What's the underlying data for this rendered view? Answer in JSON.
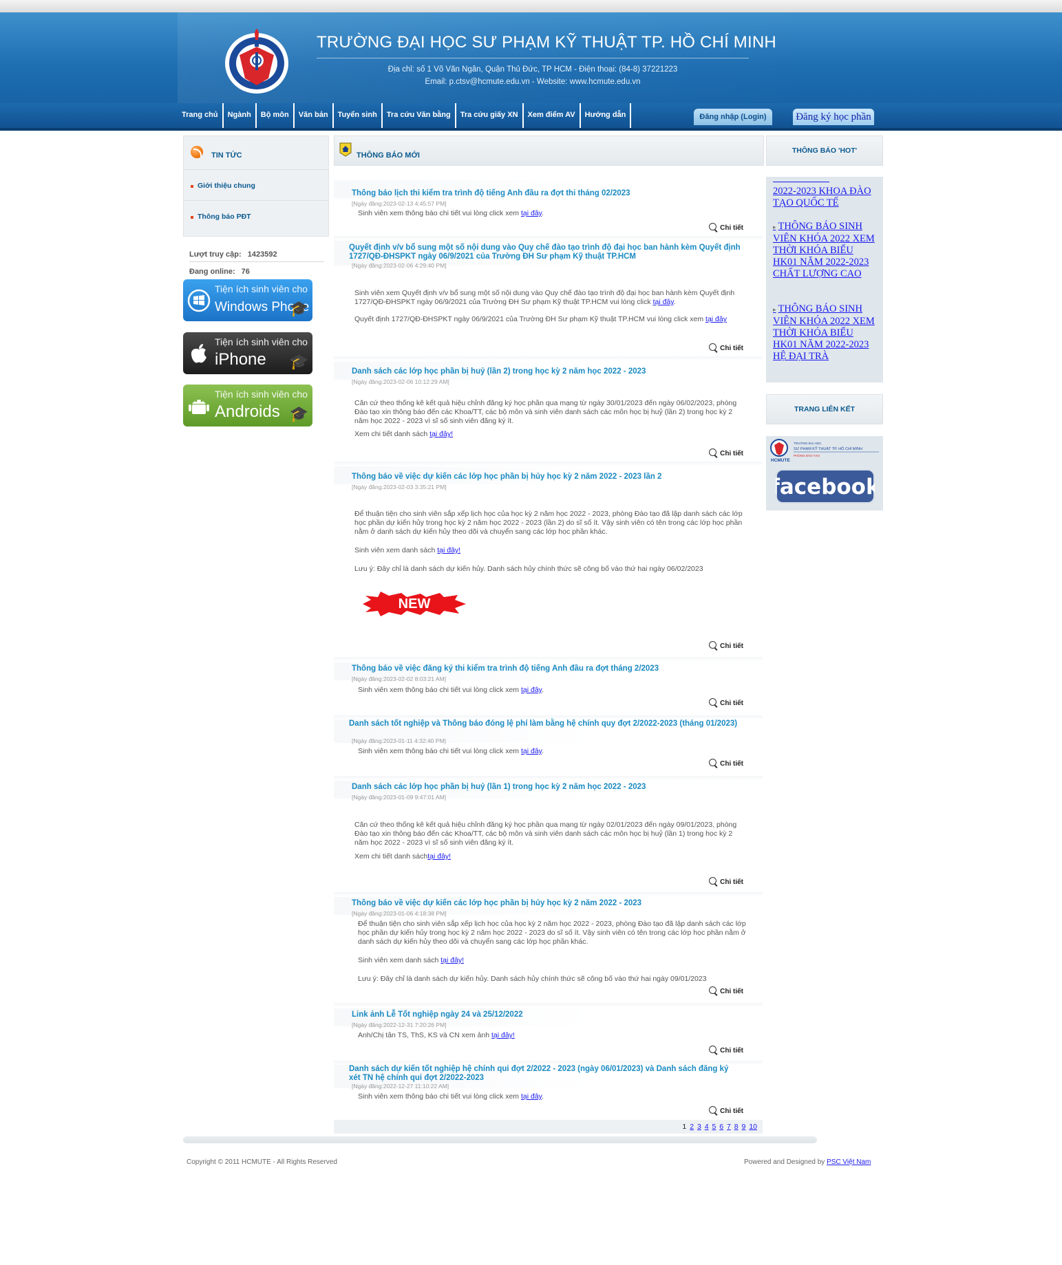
{
  "header": {
    "university_name": "TRƯỜNG ĐẠI HỌC SƯ PHẠM KỸ THUẬT TP. HỒ CHÍ MINH",
    "address_line": "Địa chỉ: số 1 Võ Văn Ngân, Quận Thủ Đức, TP HCM - Điện thoại: (84-8) 37221223",
    "contact_line": "Email: p.ctsv@hcmute.edu.vn - Website: www.hcmute.edu.vn",
    "logo_icon": "university-logo"
  },
  "nav": {
    "items": [
      "Trang chủ",
      "Ngành",
      "Bộ môn",
      "Văn bản",
      "Tuyển sinh",
      "Tra cứu Văn bằng",
      "Tra cứu giấy XN",
      "Xem điểm AV",
      "Hướng dẫn"
    ],
    "login": "Đăng nhập (Login)",
    "register": "Đăng ký học phần"
  },
  "left": {
    "news_title": "TIN TỨC",
    "links": [
      "Giới thiệu chung",
      "Thông báo PĐT"
    ],
    "visits_label": "Lượt truy cập:",
    "visits_value": "1423592",
    "online_label": "Đang online:",
    "online_value": "76",
    "app_prefix": "Tiện ích sinh viên cho",
    "apps": [
      "Windows Phone",
      "iPhone",
      "Androids"
    ]
  },
  "center": {
    "title": "THÔNG BÁO MỚI",
    "more_label": "Chi tiết",
    "here": "tại đây",
    "here_bang": "tại đây!",
    "new_badge": "NEW",
    "items": [
      {
        "title": "Thông báo lịch thi kiểm tra trình độ tiếng Anh đầu ra đợt thi tháng 02/2023",
        "date": "[Ngày đăng:2023-02-13 4:45:57 PM]",
        "body": "Sinh viên xem thông báo chi tiết vui lòng click xem"
      },
      {
        "title": "Quyết định v/v bổ sung một số nội dung vào Quy chế đào tạo trình độ đại học ban hành kèm Quyết định 1727/QĐ-ĐHSPKT ngày 06/9/2021 của Trường ĐH Sư phạm Kỹ thuật TP.HCM",
        "date": "[Ngày đăng:2023-02-06 4:29:40 PM]",
        "body": "Sinh viên xem Quyết định v/v bổ sung một số nội dung vào Quy chế đào tạo trình độ đại học ban hành kèm Quyết định 1727/QĐ-ĐHSPKT ngày 06/9/2021 của Trường ĐH Sư phạm Kỹ thuật TP.HCM vui lòng click",
        "body2": "Quyết định 1727/QĐ-ĐHSPKT ngày 06/9/2021 của Trường ĐH Sư phạm Kỹ thuật TP.HCM vui lòng click xem"
      },
      {
        "title": "Danh sách các lớp học phần bị huỷ (lần 2) trong học kỳ 2 năm học 2022 - 2023",
        "date": "[Ngày đăng:2023-02-06 10:12:29 AM]",
        "body": "Căn cứ theo thống kê kết quả hiệu chỉnh đăng ký học phần qua mạng từ ngày 30/01/2023 đến ngày 06/02/2023, phòng Đào tạo xin thông báo đến các Khoa/TT, các bộ môn và sinh viên danh sách các môn học bị huỷ (lần 2) trong học kỳ 2 năm học 2022 - 2023 vì sĩ số sinh viên đăng ký ít.",
        "body2": "Xem chi tiết danh sách"
      },
      {
        "title": "Thông báo về việc dự kiến các lớp học phần bị hủy học kỳ 2 năm 2022 - 2023 lần 2",
        "date": "[Ngày đăng:2023-02-03 3:35:21 PM]",
        "body": "Để thuận tiện cho sinh viên sắp xếp lịch học của học kỳ 2 năm học 2022 - 2023, phòng Đào tạo đã lập danh sách các lớp học phần dự kiến hủy trong học kỳ 2 năm học 2022 - 2023 (lần 2) do sĩ số ít. Vậy sinh viên có tên trong các lớp học phần nằm ở danh sách dự kiến hủy theo dõi và chuyển sang các lớp học phần khác.",
        "body2": "Sinh viên xem danh sách",
        "body3": "Lưu ý: Đây chỉ là danh sách dự kiến hủy. Danh sách hủy chính thức sẽ công bố vào thứ hai ngày 06/02/2023"
      },
      {
        "title": "Thông báo về việc đăng ký thi kiểm tra trình độ tiếng Anh đầu ra đợt tháng 2/2023",
        "date": "[Ngày đăng:2023-02-02 8:03:21 AM]",
        "body": "Sinh viên xem thông báo chi tiết vui lòng click xem"
      },
      {
        "title": "Danh sách tốt nghiệp và Thông báo đóng lệ phí làm bằng hệ chính quy đợt 2/2022-2023 (tháng 01/2023)",
        "date": "[Ngày đăng:2023-01-11 4:32:40 PM]",
        "body": "Sinh viên xem thông báo chi tiết vui lòng click xem"
      },
      {
        "title": "Danh sách các lớp học phần bị huỷ (lần 1) trong học kỳ 2 năm học 2022 - 2023",
        "date": "[Ngày đăng:2023-01-09 9:47:01 AM]",
        "body": "Căn cứ theo thống kê kết quả hiệu chỉnh đăng ký học phần qua mạng từ ngày 02/01/2023 đến ngày 09/01/2023, phòng Đào tạo xin thông báo đến các Khoa/TT, các bộ môn và sinh viên danh sách các môn học bị huỷ (lần 1) trong học kỳ 2 năm học 2022 - 2023 vì sĩ số sinh viên đăng ký ít.",
        "body2": "Xem chi tiết danh sách"
      },
      {
        "title": "Thông báo về việc dự kiến các lớp học phần bị hủy học kỳ 2 năm 2022 - 2023",
        "date": "[Ngày đăng:2023-01-06 4:18:38 PM]",
        "body": "Để thuận tiện cho sinh viên sắp xếp lịch học của học kỳ 2 năm học 2022 - 2023, phòng Đào tạo đã lập danh sách các lớp học phần dự kiến hủy trong học kỳ 2 năm học 2022 - 2023 do sĩ số ít. Vậy sinh viên có tên trong các lớp học phần nằm ở danh sách dự kiến hủy theo dõi và chuyển sang các lớp học phần khác.",
        "body2": "Sinh viên xem danh sách",
        "body3": "Lưu ý: Đây chỉ là danh sách dự kiến hủy. Danh sách hủy chính thức sẽ công bố vào thứ hai ngày 09/01/2023"
      },
      {
        "title": "Link ảnh Lễ Tốt nghiệp ngày 24 và 25/12/2022",
        "date": "[Ngày đăng:2022-12-31 7:20:26 PM]",
        "body": "Anh/Chị tân TS, ThS, KS và CN xem ảnh"
      },
      {
        "title": "Danh sách dự kiến tốt nghiệp hệ chính qui đợt 2/2022 - 2023 (ngày 06/01/2023) và Danh sách đăng ký xét TN hệ chính qui đợt 2/2022-2023",
        "date": "[Ngày đăng:2022-12-27 11:10:22 AM]",
        "body": "Sinh viên xem thông báo chi tiết vui lòng click xem"
      }
    ],
    "pager": [
      "1",
      "2",
      "3",
      "4",
      "5",
      "6",
      "7",
      "8",
      "9",
      "10"
    ]
  },
  "right": {
    "hot_title": "THÔNG BÁO 'HOT'",
    "hot_links": [
      "2022-2023 KHOA ĐÀO TẠO QUỐC TẾ",
      "THÔNG BÁO SINH VIÊN KHÓA 2022 XEM THỜI KHÓA BIỂU HK01 NĂM 2022-2023 CHẤT LƯỢNG CAO",
      "THÔNG BÁO SINH VIÊN KHÓA 2022 XEM THỜI KHÓA BIỂU HK01 NĂM 2022-2023 HỆ ĐẠI TRÀ"
    ],
    "links_title": "TRANG LIÊN KẾT",
    "hcmute_logo_lines": [
      "TRƯỜNG ĐẠI HỌC",
      "SƯ PHẠM KỸ THUẬT TP. HỒ CHÍ MINH",
      "PHÒNG ĐÀO TẠO",
      "HCMUTE"
    ],
    "facebook": "facebook"
  },
  "footer": {
    "copyright": "Copyright © 2011 HCMUTE - All Rights Reserved",
    "powered_prefix": "Powered and Designed by",
    "powered_link": "PSC Việt Nam"
  },
  "colors": {
    "header_blue": "#1e6eb2",
    "link_blue": "#1a1aee",
    "title_blue": "#1a8ac2",
    "heading_blue": "#0b5a8f"
  }
}
